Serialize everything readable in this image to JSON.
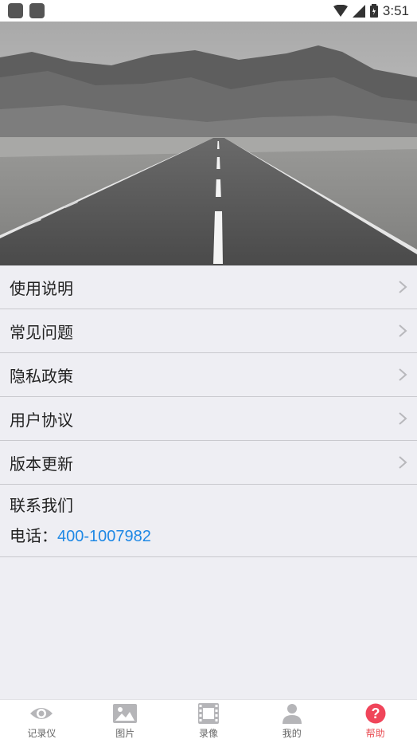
{
  "status_bar": {
    "time": "3:51"
  },
  "menu": {
    "items": [
      {
        "label": "使用说明"
      },
      {
        "label": "常见问题"
      },
      {
        "label": "隐私政策"
      },
      {
        "label": "用户协议"
      },
      {
        "label": "版本更新"
      }
    ]
  },
  "contact": {
    "title": "联系我们",
    "phone_prefix": "电话：",
    "phone_number": "400-1007982"
  },
  "bottom_nav": {
    "items": [
      {
        "label": "记录仪",
        "icon": "eye-icon"
      },
      {
        "label": "图片",
        "icon": "image-icon"
      },
      {
        "label": "录像",
        "icon": "film-icon"
      },
      {
        "label": "我的",
        "icon": "person-icon"
      },
      {
        "label": "帮助",
        "icon": "help-icon",
        "active": true
      }
    ],
    "active_color": "#e94f55",
    "inactive_color": "#8e8e93"
  },
  "colors": {
    "link": "#1e88e5",
    "background": "#eeeef3"
  }
}
